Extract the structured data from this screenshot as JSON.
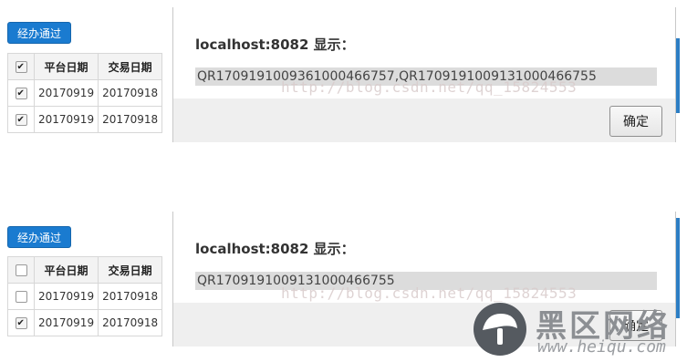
{
  "panels": [
    {
      "approve_label": "经办通过",
      "headers": {
        "platform_date": "平台日期",
        "trade_date": "交易日期"
      },
      "header_checked": true,
      "rows": [
        {
          "checked": true,
          "platform_date": "20170919",
          "trade_date": "20170918"
        },
        {
          "checked": true,
          "platform_date": "20170919",
          "trade_date": "20170918"
        }
      ],
      "dialog": {
        "title": "localhost:8082 显示：",
        "message": "QR170919100936100046675​7,QR17091910091310004667​55",
        "ok_label": "确定"
      },
      "watermark": "http://blog.csdn.net/qq_15824553"
    },
    {
      "approve_label": "经办通过",
      "headers": {
        "platform_date": "平台日期",
        "trade_date": "交易日期"
      },
      "header_checked": false,
      "rows": [
        {
          "checked": false,
          "platform_date": "20170919",
          "trade_date": "20170918"
        },
        {
          "checked": true,
          "platform_date": "20170919",
          "trade_date": "20170918"
        }
      ],
      "dialog": {
        "title": "localhost:8082 显示：",
        "message": "QR17091910091310004667​55",
        "ok_label": "确定"
      },
      "watermark": "http://blog.csdn.net/qq_15824553"
    }
  ],
  "logo": {
    "chinese": "黑区网络",
    "url": "www.heiqu.com"
  },
  "colors": {
    "accent": "#1a7bd0",
    "dialog_footer": "#efefef",
    "message_bg": "#dcdcdc"
  }
}
